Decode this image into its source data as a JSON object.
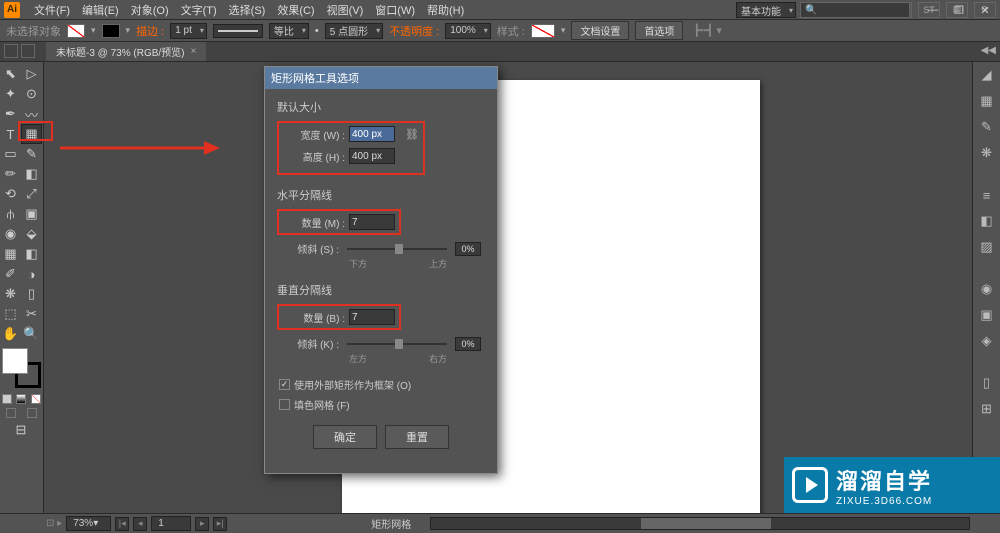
{
  "app": {
    "logo": "Ai"
  },
  "menu": {
    "file": "文件(F)",
    "edit": "编辑(E)",
    "object": "对象(O)",
    "type": "文字(T)",
    "select": "选择(S)",
    "effect": "效果(C)",
    "view": "视图(V)",
    "window": "窗口(W)",
    "help": "帮助(H)"
  },
  "top_right_icons": [
    "■",
    "ST",
    "▦",
    "⟳"
  ],
  "workspace_label": "基本功能",
  "window_controls": {
    "min": "—",
    "restore": "❐",
    "close": "✕"
  },
  "control": {
    "no_selection": "未选择对象",
    "stroke_label": "描边 :",
    "stroke_weight": "1 pt",
    "uniform": "等比",
    "profile": "5 点圆形",
    "opacity_label": "不透明度 :",
    "opacity": "100%",
    "style_label": "样式 :",
    "doc_setup": "文档设置",
    "prefs": "首选项"
  },
  "tab": {
    "title": "未标题-3 @ 73% (RGB/预览)",
    "close": "×"
  },
  "toolbox": {
    "tools": [
      "⬉",
      "▦",
      "⬉",
      "✿",
      "✒",
      "T",
      "╱",
      "▭",
      "✎",
      "◌",
      "✂",
      "⟲",
      "✥",
      "▨",
      "⊞",
      "⌗",
      "◧",
      "✋",
      "◑",
      "⬚",
      "🔍"
    ],
    "grid_tool": "▦"
  },
  "dialog": {
    "title": "矩形网格工具选项",
    "default_size": "默认大小",
    "width_label": "宽度 (W) :",
    "width_value": "400 px",
    "height_label": "高度 (H) :",
    "height_value": "400 px",
    "h_dividers": "水平分隔线",
    "count_m_label": "数量 (M) :",
    "count_m_value": "7",
    "skew_s_label": "倾斜 (S) :",
    "skew_value": "0%",
    "bottom_label": "下方",
    "top_label": "上方",
    "v_dividers": "垂直分隔线",
    "count_b_label": "数量 (B) :",
    "count_b_value": "7",
    "skew_k_label": "倾斜 (K) :",
    "left_label": "左方",
    "right_label": "右方",
    "use_frame": "使用外部矩形作为框架 (O)",
    "fill_grid": "填色网格 (F)",
    "ok": "确定",
    "reset": "重置"
  },
  "status": {
    "zoom": "73%",
    "page": "1",
    "tool_info": "矩形网格"
  },
  "watermark": {
    "title": "溜溜自学",
    "url": "ZIXUE.3D66.COM"
  }
}
